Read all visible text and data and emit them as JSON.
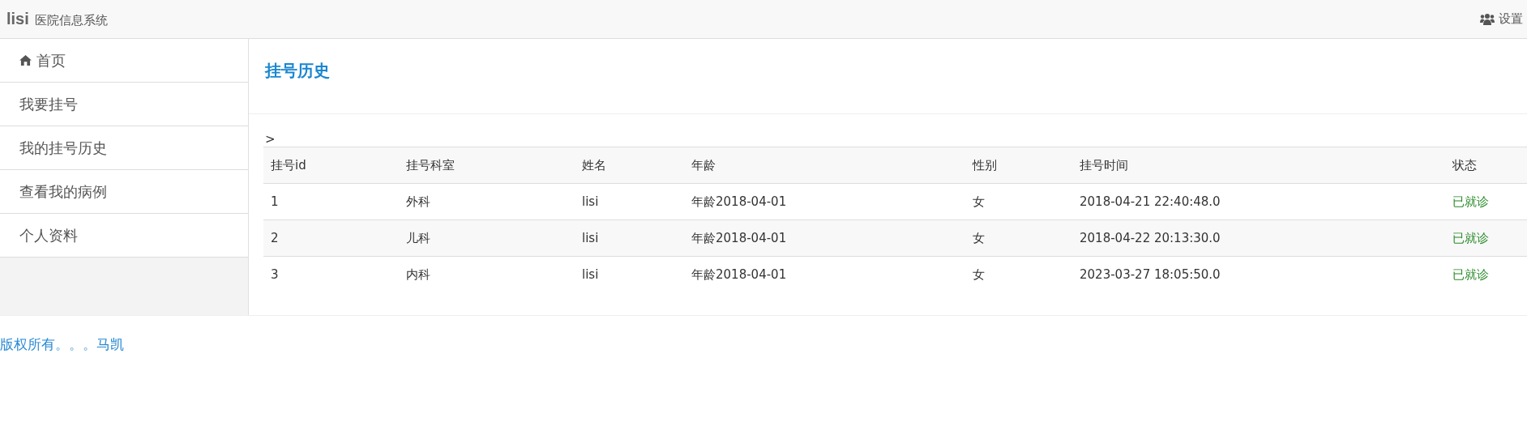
{
  "navbar": {
    "brand": "lisi",
    "subtitle": "医院信息系统",
    "settings_label": "设置"
  },
  "sidebar": {
    "items": [
      {
        "label": "首页",
        "kind": "home",
        "selected": false
      },
      {
        "label": "我要挂号",
        "kind": "plain",
        "selected": false
      },
      {
        "label": "我的挂号历史",
        "kind": "plain",
        "selected": false
      },
      {
        "label": "查看我的病例",
        "kind": "plain",
        "selected": false
      },
      {
        "label": "个人资料",
        "kind": "plain",
        "selected": false
      }
    ]
  },
  "page_title": "挂号历史",
  "breadcrumb": ">",
  "table": {
    "columns": [
      "挂号id",
      "挂号科室",
      "姓名",
      "年龄",
      "性别",
      "挂号时间",
      "状态"
    ],
    "rows": [
      [
        "1",
        "外科",
        "lisi",
        "年龄2018-04-01",
        "女",
        "2018-04-21 22:40:48.0",
        "已就诊"
      ],
      [
        "2",
        "儿科",
        "lisi",
        "年龄2018-04-01",
        "女",
        "2018-04-22 20:13:30.0",
        "已就诊"
      ],
      [
        "3",
        "内科",
        "lisi",
        "年龄2018-04-01",
        "女",
        "2023-03-27 18:05:50.0",
        "已就诊"
      ]
    ]
  },
  "footer": "版权所有。。。马凯"
}
